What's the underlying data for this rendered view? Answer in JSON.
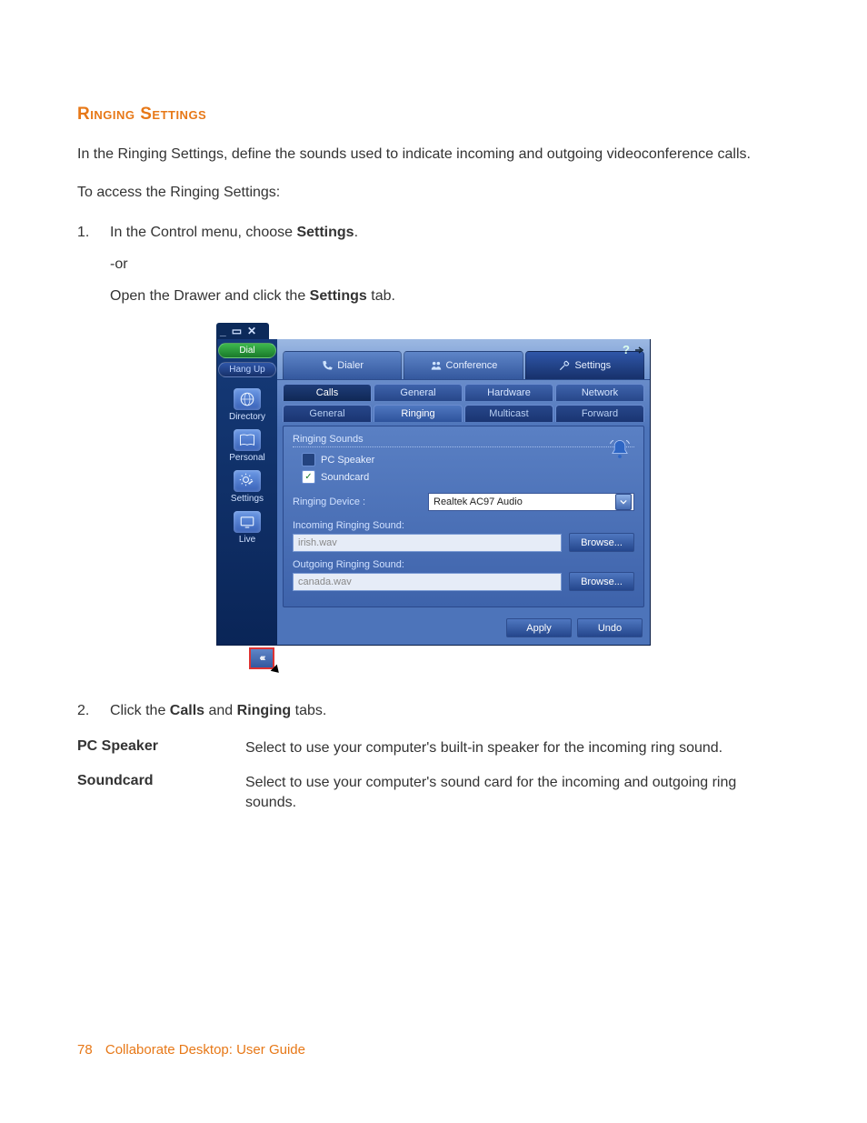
{
  "heading": "Ringing Settings",
  "intro": "In the Ringing Settings, define the sounds used to indicate incoming and outgoing videoconference calls.",
  "access_line": "To access the Ringing Settings:",
  "step1_num": "1.",
  "step1_prefix": "In the Control menu, choose ",
  "step1_bold": "Settings",
  "step1_suffix": ".",
  "or_text": "-or",
  "step1b_prefix": "Open the Drawer and click the ",
  "step1b_bold": "Settings",
  "step1b_suffix": " tab.",
  "step2_num": "2.",
  "step2_prefix": "Click the ",
  "step2_bold1": "Calls",
  "step2_mid": " and ",
  "step2_bold2": "Ringing",
  "step2_suffix": " tabs.",
  "defs": {
    "pcspeaker_term": "PC Speaker",
    "pcspeaker_desc": "Select to use your computer's built-in speaker for the incoming ring sound.",
    "soundcard_term": "Soundcard",
    "soundcard_desc": "Select to use your computer's sound card for the incoming and outgoing ring sounds."
  },
  "footer": {
    "page": "78",
    "title": "Collaborate Desktop: User Guide"
  },
  "shot": {
    "left": {
      "dial": "Dial",
      "hangup": "Hang Up",
      "directory": "Directory",
      "personal": "Personal",
      "settings": "Settings",
      "live": "Live"
    },
    "top_tabs": {
      "dialer": "Dialer",
      "conference": "Conference",
      "settings": "Settings"
    },
    "help": "?",
    "row1": {
      "calls": "Calls",
      "general": "General",
      "hardware": "Hardware",
      "network": "Network"
    },
    "row2": {
      "general": "General",
      "ringing": "Ringing",
      "multicast": "Multicast",
      "forward": "Forward"
    },
    "panel": {
      "fieldset": "Ringing Sounds",
      "pcspeaker": "PC Speaker",
      "soundcard": "Soundcard",
      "device_label": "Ringing Device :",
      "device_value": "Realtek AC97 Audio",
      "incoming_label": "Incoming Ringing Sound:",
      "incoming_value": "irish.wav",
      "outgoing_label": "Outgoing Ringing Sound:",
      "outgoing_value": "canada.wav",
      "browse": "Browse...",
      "browse_u": "B",
      "apply": "Apply",
      "undo": "Undo"
    },
    "drawer_arrows": "‹‹‹"
  }
}
